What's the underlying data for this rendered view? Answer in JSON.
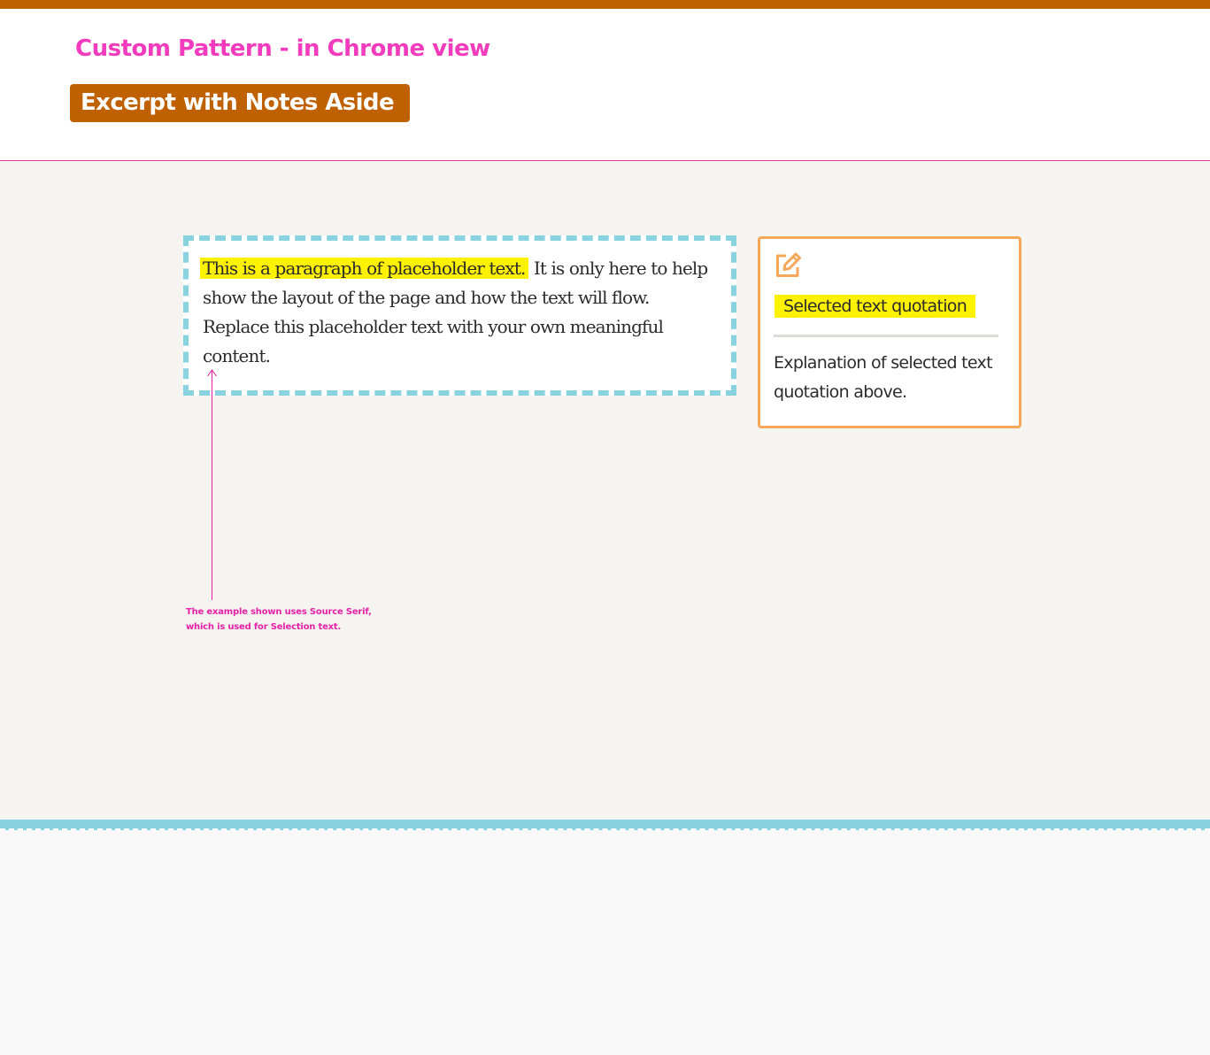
{
  "header": {
    "title": "Custom Pattern - in Chrome view",
    "badge": "Excerpt with Notes Aside"
  },
  "excerpt": {
    "highlighted": "This is a paragraph of placeholder text.",
    "rest": " It is only here to help show the layout of the page and how the text will flow. Replace this placeholder text with your own meaningful content."
  },
  "note": {
    "icon": "edit-icon",
    "quote": "Selected text quotation",
    "explanation": "Explanation of selected text quotation above."
  },
  "annotation": {
    "text": "The example shown uses Source Serif, which is used for Selection text."
  },
  "colors": {
    "accent": "#bf6100",
    "title_pink": "#f23bbd",
    "highlight": "#fff200",
    "dashed_border": "#89d2e0",
    "note_border": "#f6a75a"
  }
}
